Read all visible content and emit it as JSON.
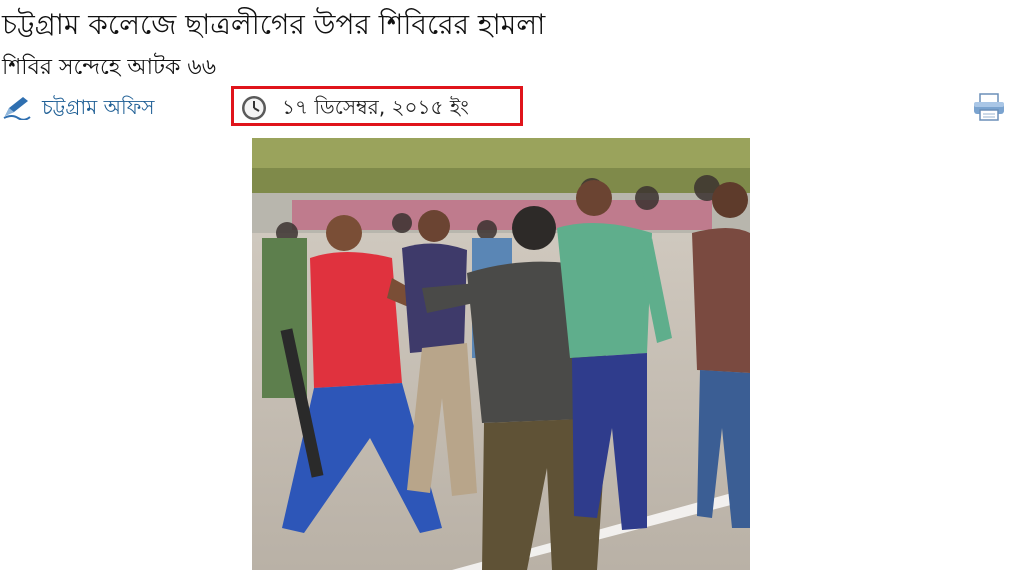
{
  "article": {
    "headline": "চট্টগ্রাম কলেজে ছাত্রলীগের উপর শিবিরের হামলা",
    "subheadline": "শিবির সন্দেহে আটক ৬৬",
    "author": "চট্টগ্রাম অফিস",
    "author_prefix": "",
    "date": "১৭ ডিসেম্বর, ২০১৫ ইং"
  },
  "icons": {
    "author": "pen-icon",
    "date": "clock-icon",
    "print": "printer-icon"
  },
  "colors": {
    "link": "#1f5f95",
    "highlight_border": "#e0141b"
  }
}
